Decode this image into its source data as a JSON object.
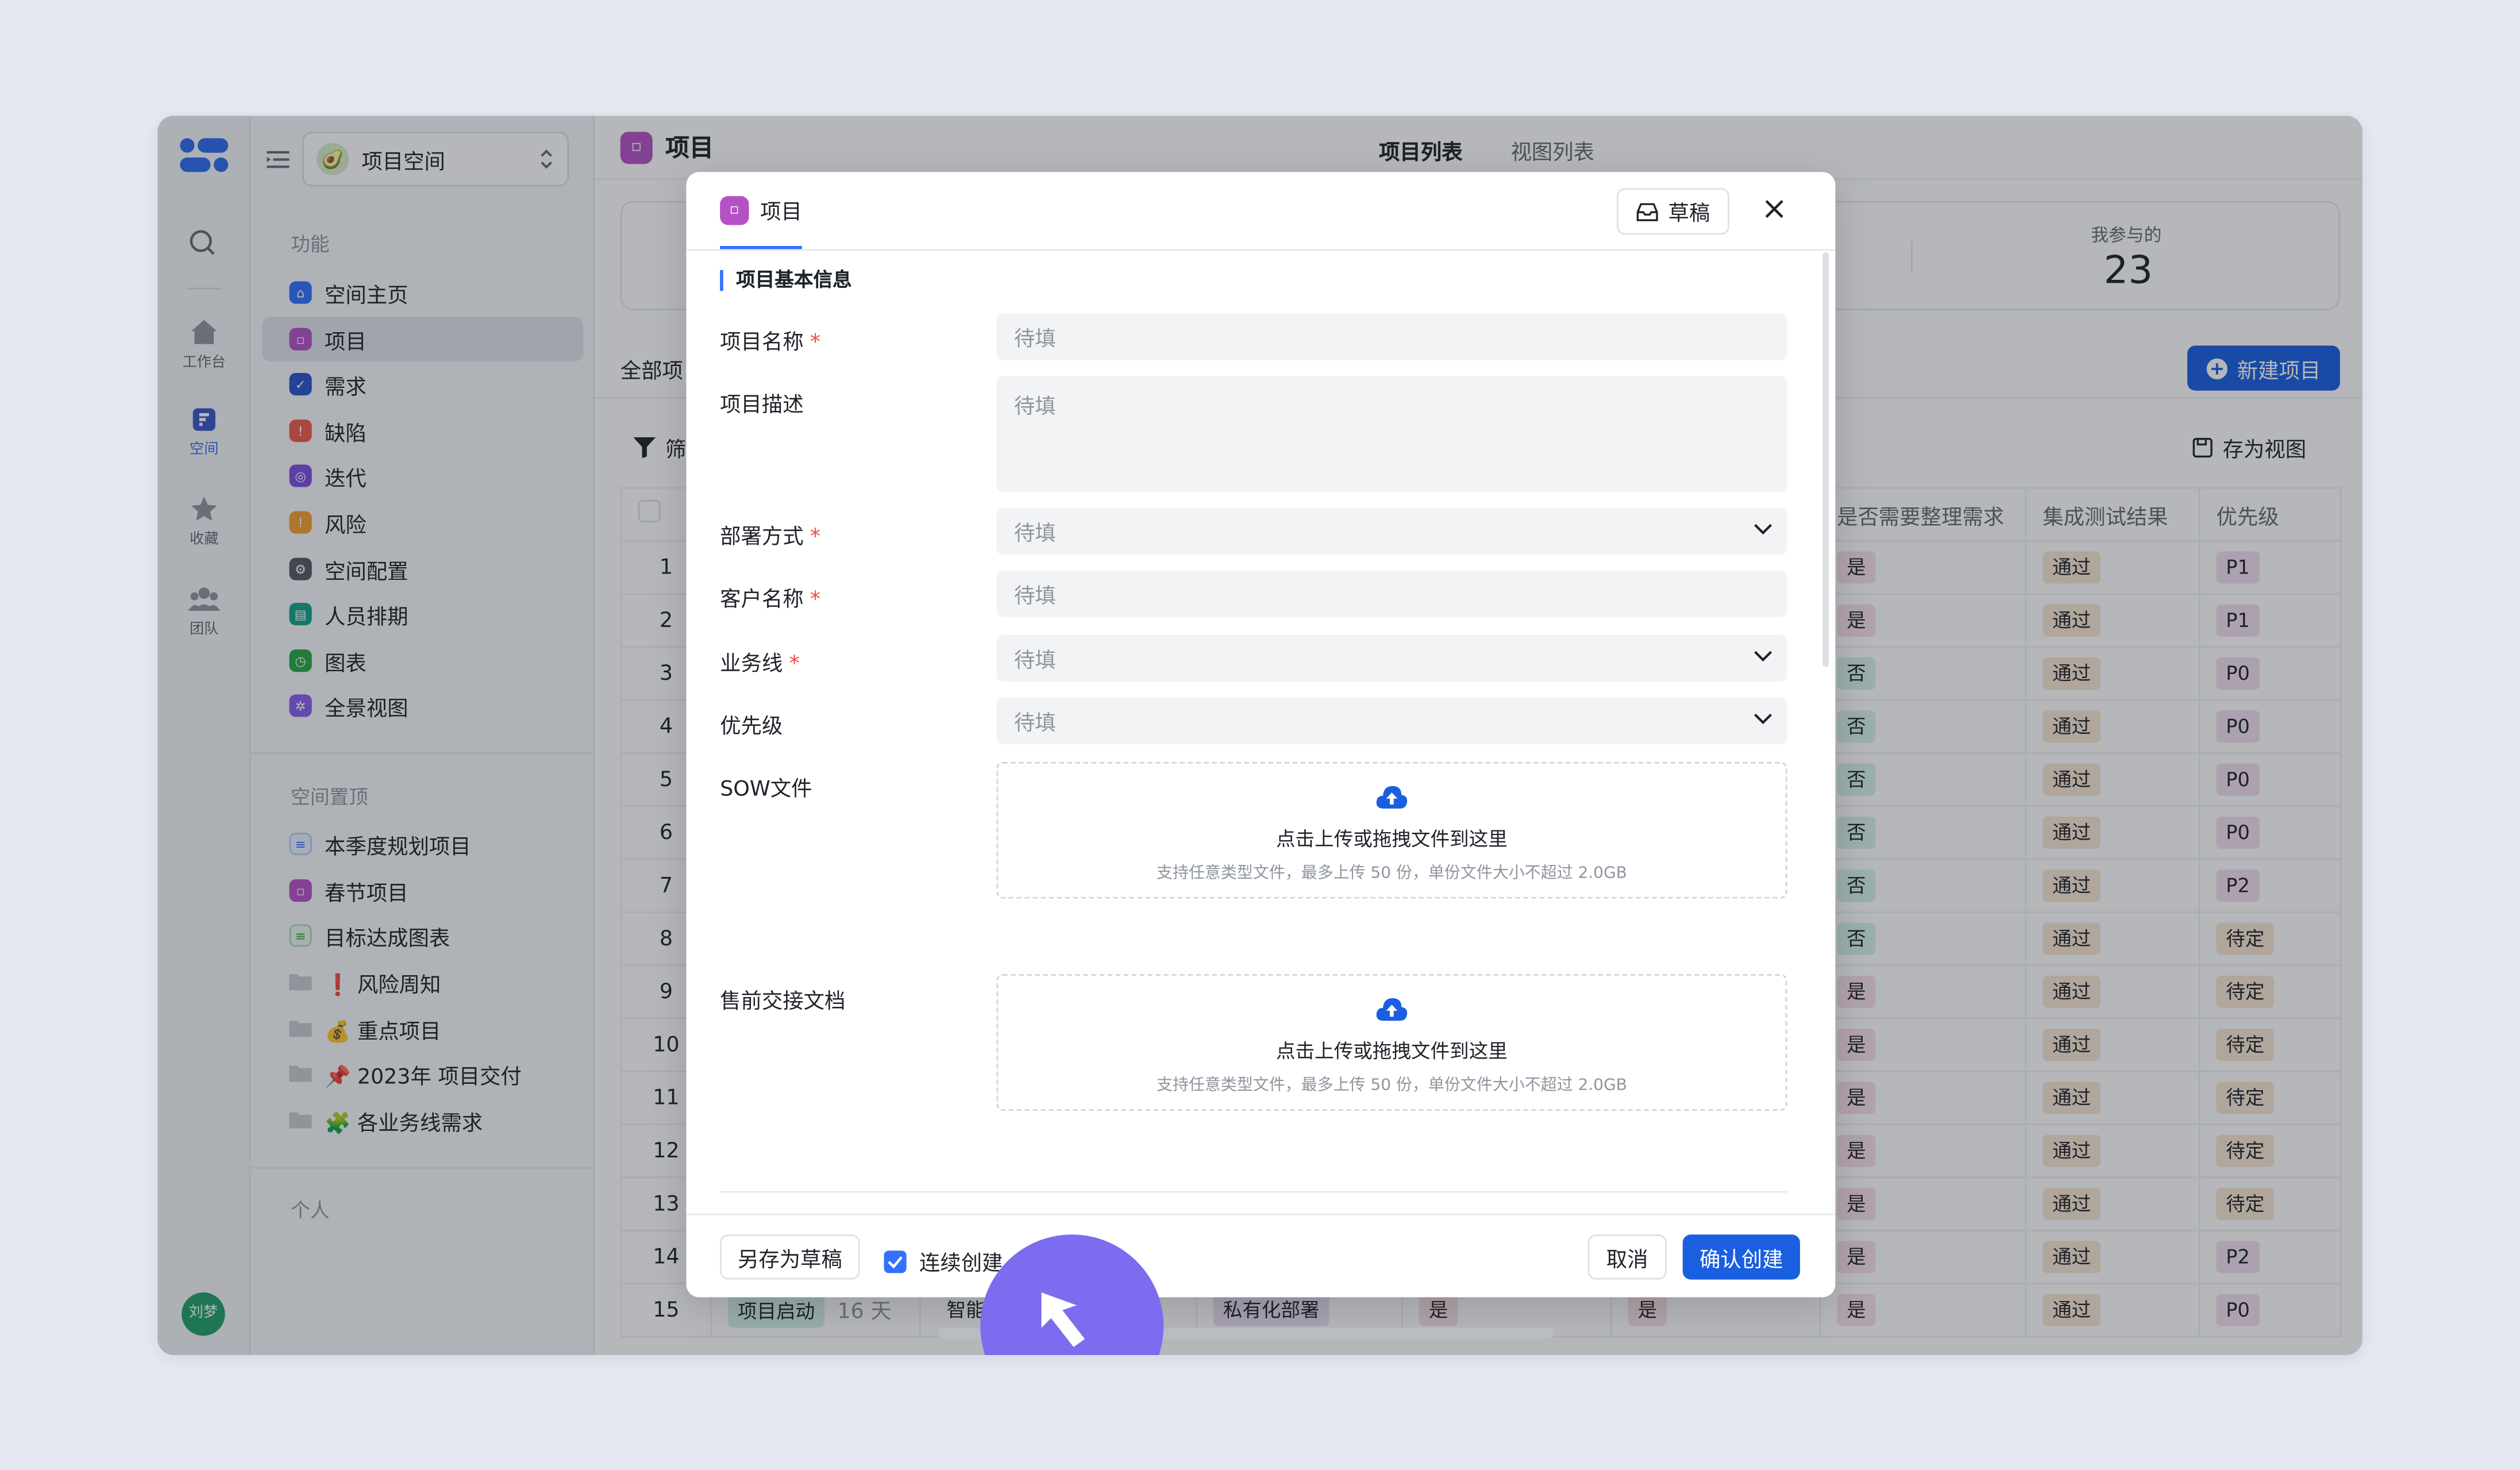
{
  "rail": {
    "items": [
      {
        "label": "工作台"
      },
      {
        "label": "空间"
      },
      {
        "label": "收藏"
      },
      {
        "label": "团队"
      }
    ],
    "user_name": "刘梦"
  },
  "sidebar": {
    "space_name": "项目空间",
    "groups": {
      "features": "功能",
      "pinned": "空间置顶",
      "personal": "个人"
    },
    "features": [
      {
        "label": "空间主页",
        "color": "#3370ff",
        "icon": "home-icon"
      },
      {
        "label": "项目",
        "color": "#b451c4",
        "icon": "project-icon"
      },
      {
        "label": "需求",
        "color": "#2a55c9",
        "icon": "requirement-icon"
      },
      {
        "label": "缺陷",
        "color": "#f15a4a",
        "icon": "bug-icon"
      },
      {
        "label": "迭代",
        "color": "#7b4fe0",
        "icon": "iteration-icon"
      },
      {
        "label": "风险",
        "color": "#f5a02f",
        "icon": "risk-icon"
      },
      {
        "label": "空间配置",
        "color": "#555a63",
        "icon": "settings-icon"
      },
      {
        "label": "人员排期",
        "color": "#12a38a",
        "icon": "schedule-icon"
      },
      {
        "label": "图表",
        "color": "#27a844",
        "icon": "chart-icon"
      },
      {
        "label": "全景视图",
        "color": "#8a5cf0",
        "icon": "panorama-icon"
      }
    ],
    "pinned": [
      {
        "label": "本季度规划项目",
        "icon": "list-icon"
      },
      {
        "label": "春节项目",
        "icon": "project-icon"
      },
      {
        "label": "目标达成图表",
        "icon": "list-icon"
      },
      {
        "label": "❗ 风险周知",
        "icon": "folder-icon"
      },
      {
        "label": "💰 重点项目",
        "icon": "folder-icon"
      },
      {
        "label": "📌 2023年 项目交付",
        "icon": "folder-icon"
      },
      {
        "label": "🧩 各业务线需求",
        "icon": "folder-icon"
      }
    ]
  },
  "main": {
    "title": "项目",
    "tabs": [
      "项目列表",
      "视图列表"
    ],
    "stat_label": "我参与的",
    "stat_value": "23",
    "all_tab": "全部项",
    "new_button": "新建项目",
    "filter_label": "筛",
    "save_view": "存为视图",
    "columns": [
      "是否需要整理需求",
      "集成测试结果",
      "优先级"
    ],
    "rows": [
      {
        "n": "1",
        "need": "是",
        "test": "通过",
        "pri": "P1"
      },
      {
        "n": "2",
        "need": "是",
        "test": "通过",
        "pri": "P1"
      },
      {
        "n": "3",
        "need": "否",
        "test": "通过",
        "pri": "P0"
      },
      {
        "n": "4",
        "need": "否",
        "test": "通过",
        "pri": "P0"
      },
      {
        "n": "5",
        "need": "否",
        "test": "通过",
        "pri": "P0"
      },
      {
        "n": "6",
        "need": "否",
        "test": "通过",
        "pri": "P0"
      },
      {
        "n": "7",
        "need": "否",
        "test": "通过",
        "pri": "P2"
      },
      {
        "n": "8",
        "need": "否",
        "test": "通过",
        "pri": "待定"
      },
      {
        "n": "9",
        "need": "是",
        "test": "通过",
        "pri": "待定"
      },
      {
        "n": "10",
        "need": "是",
        "test": "通过",
        "pri": "待定"
      },
      {
        "n": "11",
        "need": "是",
        "test": "通过",
        "pri": "待定"
      },
      {
        "n": "12",
        "need": "是",
        "test": "通过",
        "pri": "待定"
      },
      {
        "n": "13",
        "need": "是",
        "test": "通过",
        "pri": "待定"
      },
      {
        "n": "14",
        "need": "是",
        "test": "通过",
        "pri": "P2"
      },
      {
        "n": "15",
        "need": "是",
        "test": "通过",
        "pri": "P0"
      }
    ],
    "row15": {
      "stage": "项目启动",
      "days": "16 天",
      "name": "智能",
      "deploy": "私有化部署",
      "a": "是",
      "b": "是"
    }
  },
  "modal": {
    "tab": "项目",
    "draft_button": "草稿",
    "section": "项目基本信息",
    "fields": {
      "name": {
        "label": "项目名称",
        "placeholder": "待填"
      },
      "desc": {
        "label": "项目描述",
        "placeholder": "待填"
      },
      "deploy": {
        "label": "部署方式",
        "placeholder": "待填"
      },
      "customer": {
        "label": "客户名称",
        "placeholder": "待填"
      },
      "business": {
        "label": "业务线",
        "placeholder": "待填"
      },
      "priority": {
        "label": "优先级",
        "placeholder": "待填"
      },
      "sow": {
        "label": "SOW文件"
      },
      "presale": {
        "label": "售前交接文档"
      }
    },
    "upload_title": "点击上传或拖拽文件到这里",
    "upload_hint": "支持任意类型文件，最多上传 50 份，单份文件大小不超过 2.0GB",
    "save_draft": "另存为草稿",
    "continuous": "连续创建",
    "cancel": "取消",
    "confirm": "确认创建"
  },
  "colors": {
    "accent": "#1a5fe0",
    "required": "#f54a45",
    "cursor": "#7b6cf0"
  }
}
